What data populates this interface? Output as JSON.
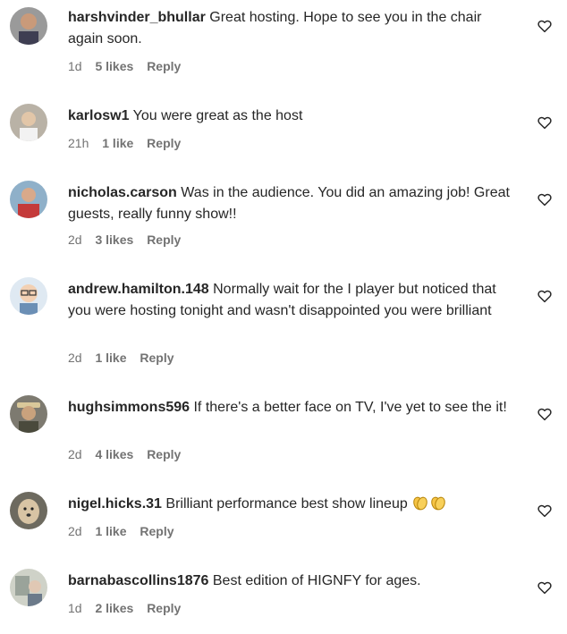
{
  "comments": [
    {
      "username": "harshvinder_bhullar",
      "text": "Great hosting. Hope to see you in the chair again soon.",
      "time": "1d",
      "likes": "5 likes",
      "reply": "Reply",
      "avatar": "avatar-man-icon",
      "heart": "heart-outline-icon"
    },
    {
      "username": "karlosw1",
      "text": "You were great as the host",
      "time": "21h",
      "likes": "1 like",
      "reply": "Reply",
      "avatar": "avatar-person-icon",
      "heart": "heart-outline-icon"
    },
    {
      "username": "nicholas.carson",
      "text": "Was in the audience. You did an amazing job! Great guests, really funny show!!",
      "time": "2d",
      "likes": "3 likes",
      "reply": "Reply",
      "avatar": "avatar-person-red-icon",
      "heart": "heart-outline-icon"
    },
    {
      "username": "andrew.hamilton.148",
      "text": "Normally wait for the I player but noticed that you were hosting tonight and wasn't disappointed you were brilliant",
      "time": "2d",
      "likes": "1 like",
      "reply": "Reply",
      "avatar": "avatar-cartoon-icon",
      "heart": "heart-outline-icon"
    },
    {
      "username": "hughsimmons596",
      "text": "If there's a better face on TV, I've yet to see the it!",
      "time": "2d",
      "likes": "4 likes",
      "reply": "Reply",
      "avatar": "avatar-hat-man-icon",
      "heart": "heart-outline-icon"
    },
    {
      "username": "nigel.hicks.31",
      "text": "Brilliant performance best show lineup",
      "time": "2d",
      "likes": "1 like",
      "reply": "Reply",
      "avatar": "avatar-dog-icon",
      "heart": "heart-outline-icon",
      "emoji": "clapping-hands-icon"
    },
    {
      "username": "barnabascollins1876",
      "text": "Best edition of HIGNFY for ages.",
      "time": "1d",
      "likes": "2 likes",
      "reply": "Reply",
      "avatar": "avatar-photo-icon",
      "heart": "heart-outline-icon"
    }
  ]
}
